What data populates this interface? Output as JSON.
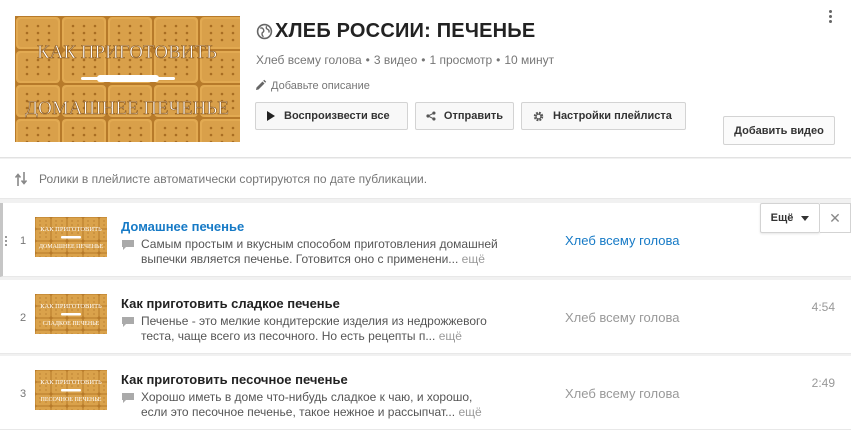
{
  "playlist": {
    "cover_line1": "КАК ПРИГОТОВИТЬ",
    "cover_line2": "ДОМАШНЕЕ ПЕЧЕНЬЕ",
    "title": "ХЛЕБ РОССИИ: ПЕЧЕНЬЕ",
    "privacy_icon": "globe-icon",
    "owner": "Хлеб всему голова",
    "video_count": "3 видео",
    "views": "1 просмотр",
    "updated": "10 минут",
    "add_description": "Добавьте описание"
  },
  "buttons": {
    "play_all": "Воспроизвести все",
    "share": "Отправить",
    "settings": "Настройки плейлиста",
    "add_video": "Добавить видео",
    "more": "Ещё",
    "remove": "✕"
  },
  "notice": "Ролики в плейлисте автоматически сортируются по дате публикации.",
  "videos": [
    {
      "index": "1",
      "title": "Домашнее печенье",
      "desc_line1": "Самым простым и вкусным способом приготовления домашней",
      "desc_line2": "выпечки является печенье. Готовится оно с применени...",
      "more": "ещё",
      "owner": "Хлеб всему голова",
      "thumb_line1": "КАК ПРИГОТОВИТЬ",
      "thumb_line2": "ДОМАШНЕЕ ПЕЧЕНЬЕ"
    },
    {
      "index": "2",
      "title": "Как приготовить сладкое печенье",
      "desc_line1": "Печенье - это мелкие кондитерские изделия из недрожжевого",
      "desc_line2": "теста, чаще всего из песочного. Но есть рецепты п...",
      "more": "ещё",
      "owner": "Хлеб всему голова",
      "duration": "4:54",
      "thumb_line1": "КАК ПРИГОТОВИТЬ",
      "thumb_line2": "СЛАДКОЕ ПЕЧЕНЬЕ"
    },
    {
      "index": "3",
      "title": "Как приготовить песочное печенье",
      "desc_line1": "Хорошо иметь в доме что-нибудь сладкое к чаю, и хорошо,",
      "desc_line2": "если это песочное печенье, такое нежное и рассыпчат...",
      "more": "ещё",
      "owner": "Хлеб всему голова",
      "duration": "2:49",
      "thumb_line1": "КАК ПРИГОТОВИТЬ",
      "thumb_line2": "ПЕСОЧНОЕ ПЕЧЕНЬЕ"
    }
  ],
  "colors": {
    "link_blue": "#167ac6",
    "cracker": "#d59a3f"
  }
}
